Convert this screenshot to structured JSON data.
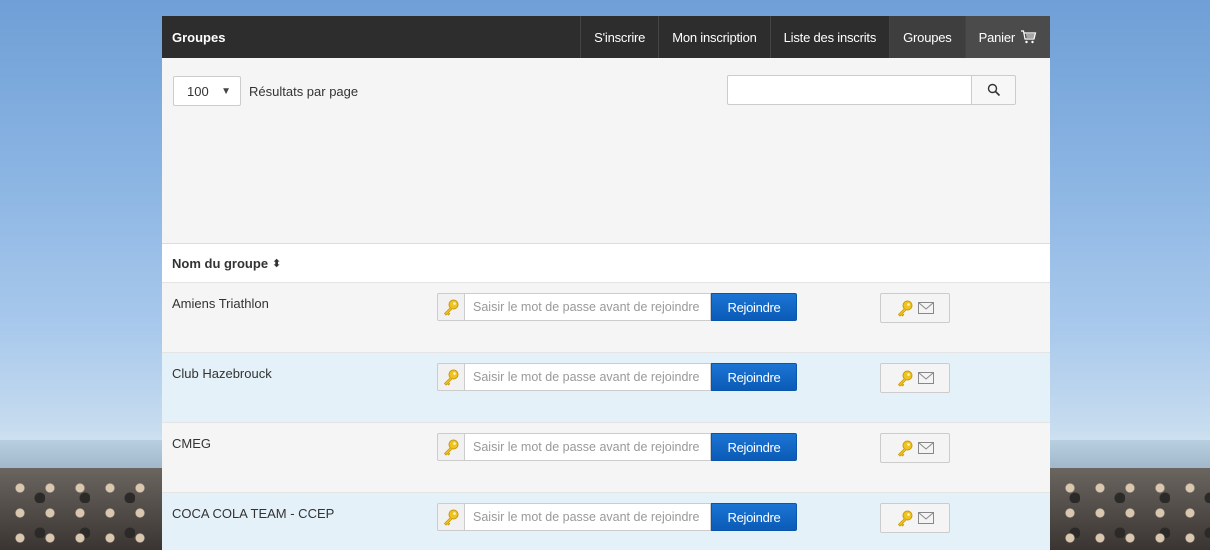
{
  "navbar": {
    "brand": "Groupes",
    "items": [
      {
        "label": "S'inscrire"
      },
      {
        "label": "Mon inscription"
      },
      {
        "label": "Liste des inscrits"
      },
      {
        "label": "Groupes"
      },
      {
        "label": "Panier"
      }
    ]
  },
  "toolbar": {
    "per_page_value": "100",
    "per_page_label": "Résultats par page",
    "search_value": ""
  },
  "table": {
    "header_name": "Nom du groupe",
    "password_placeholder": "Saisir le mot de passe avant de rejoindre",
    "join_label": "Rejoindre",
    "rows": [
      {
        "name": "Amiens Triathlon"
      },
      {
        "name": "Club Hazebrouck"
      },
      {
        "name": "CMEG"
      },
      {
        "name": "COCA COLA TEAM - CCEP"
      }
    ]
  },
  "colors": {
    "navbar_bg": "#2d2d2d",
    "join_button": "#0b5bb7",
    "row_highlight": "#e5f1f8",
    "key_icon": "#f0c420"
  },
  "icons": [
    "cart-icon",
    "search-icon",
    "sort-icon",
    "key-icon",
    "envelope-icon"
  ]
}
